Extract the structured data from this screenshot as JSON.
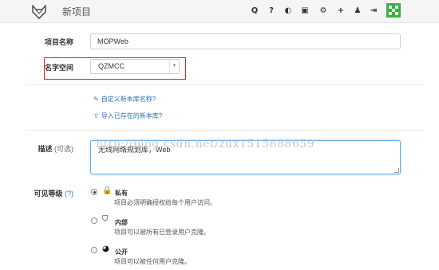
{
  "header": {
    "title": "新项目",
    "icons": [
      "search-icon",
      "question-icon",
      "explore-icon",
      "copy-icon",
      "settings-icon",
      "plus-icon",
      "user-icon",
      "signout-icon"
    ],
    "icon_glyphs": [
      "Q",
      "?",
      "◐",
      "▣",
      "⚙",
      "+",
      "♟",
      "⇥"
    ]
  },
  "form": {
    "name": {
      "label": "项目名称",
      "value": "MOPWeb"
    },
    "namespace": {
      "label": "名字空间",
      "selected": "QZMCC",
      "arrow": "▼"
    },
    "customize_link": {
      "icon": "✎",
      "text": "自定义新本库名称?"
    },
    "import_link": {
      "icon": "⇪",
      "text": "导入已存在的新本库?"
    },
    "description": {
      "label": "描述",
      "hint": "(可选)",
      "value": "无线网络规划库，Web"
    },
    "visibility": {
      "label": "可见等级",
      "help": "(?)",
      "options": [
        {
          "icon": "lock-icon",
          "glyph": "🔒",
          "title": "私有",
          "desc": "项目必须明确授权给每个用户访问。",
          "checked": true
        },
        {
          "icon": "shield-icon",
          "glyph": "⛉",
          "title": "内部",
          "desc": "项目可以被所有已登录用户克隆。",
          "checked": false
        },
        {
          "icon": "globe-icon",
          "glyph": "◕",
          "title": "公开",
          "desc": "项目可以被任何用户克隆。",
          "checked": false
        }
      ]
    }
  },
  "watermark": "http://blog.csdn.net/zdx1515888659",
  "colors": {
    "link": "#2d6fb5",
    "highlight": "#e02424",
    "focus": "#66afe9",
    "avatar": "#3cb043"
  }
}
